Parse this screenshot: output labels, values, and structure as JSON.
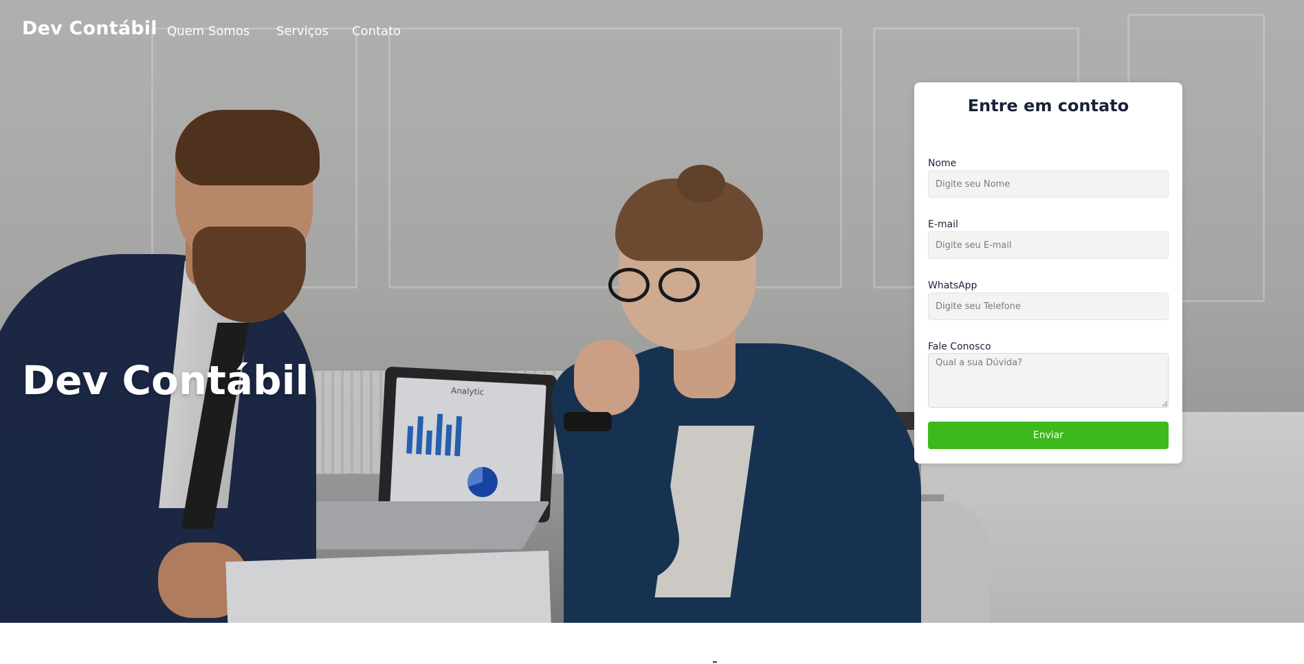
{
  "header": {
    "brand": "Dev Contábil",
    "nav": [
      {
        "label": "Quem Somos"
      },
      {
        "label": "Serviços"
      },
      {
        "label": "Contato"
      }
    ]
  },
  "hero": {
    "title": "Dev Contábil",
    "laptop_screen_text": "Analytic"
  },
  "contact_form": {
    "title": "Entre em contato",
    "fields": [
      {
        "label": "Nome",
        "placeholder": "Digite seu Nome"
      },
      {
        "label": "E-mail",
        "placeholder": "Digite seu E-mail"
      },
      {
        "label": "WhatsApp",
        "placeholder": "Digite seu Telefone"
      },
      {
        "label": "Fale Conosco",
        "placeholder": "Qual a sua Dúvida?"
      }
    ],
    "submit_label": "Enviar"
  },
  "colors": {
    "accent_green": "#3cba1b",
    "heading_navy": "#1a2238"
  }
}
